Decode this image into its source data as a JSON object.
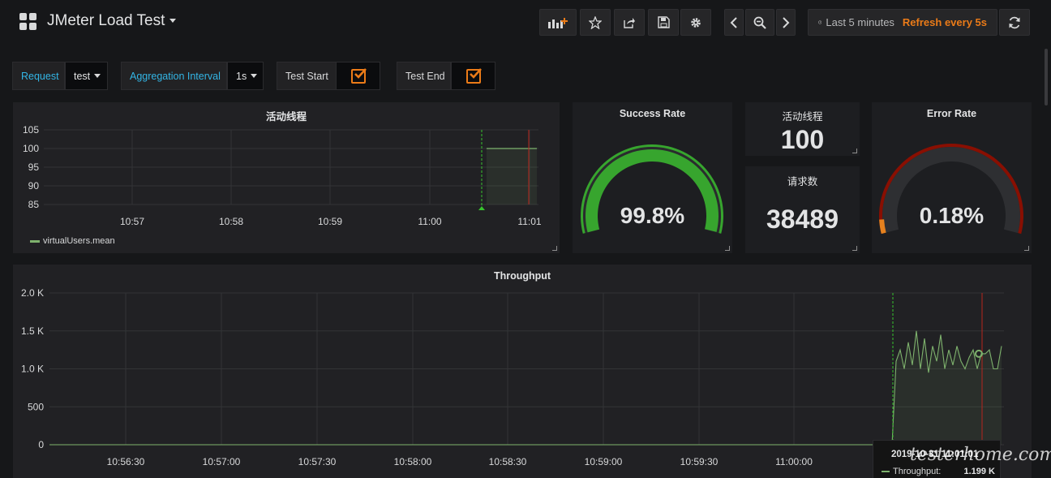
{
  "navbar": {
    "title": "JMeter Load Test",
    "icons": {
      "logo": "dashboard-grid-icon",
      "add_panel": "add-panel-icon",
      "star": "star-icon",
      "share": "share-icon",
      "save": "save-icon",
      "settings": "gear-icon",
      "prev": "chevron-left-icon",
      "zoom": "zoom-out-icon",
      "next": "chevron-right-icon",
      "clock": "clock-icon",
      "refresh": "refresh-icon"
    },
    "time_range": "Last 5 minutes",
    "refresh_label": "Refresh every 5s"
  },
  "variables": {
    "request_label": "Request",
    "request_value": "test",
    "interval_label": "Aggregation Interval",
    "interval_value": "1s",
    "test_start_label": "Test Start",
    "test_end_label": "Test End",
    "test_start_checked": true,
    "test_end_checked": true
  },
  "colors": {
    "accent_orange": "#eb7b18",
    "link_blue": "#33b5e5",
    "series_green": "#7eb26d",
    "gauge_green": "#37a52e",
    "gauge_red": "#890f02",
    "gauge_orange": "#e5811e",
    "background": "#161719",
    "panel": "#212124"
  },
  "panels": {
    "threads": {
      "title": "活动线程",
      "legend": "virtualUsers.mean"
    },
    "success_rate": {
      "title": "Success Rate",
      "value": "99.8%",
      "percent": 99.8
    },
    "threads_stat": {
      "title": "活动线程",
      "value": "100"
    },
    "requests_stat": {
      "title": "请求数",
      "value": "38489"
    },
    "error_rate": {
      "title": "Error Rate",
      "value": "0.18%",
      "percent": 0.18
    },
    "throughput": {
      "title": "Throughput",
      "tooltip_time": "2019-10-31 11:01:01",
      "tooltip_series": "Throughput:",
      "tooltip_value": "1.199 K"
    }
  },
  "chart_data": [
    {
      "type": "line",
      "title": "活动线程",
      "x_ticks": [
        "10:57",
        "10:58",
        "10:59",
        "11:00",
        "11:01"
      ],
      "y_ticks": [
        "85",
        "90",
        "95",
        "100",
        "105"
      ],
      "ylim": [
        85,
        105
      ],
      "grid": true,
      "legend_position": "bottom-left",
      "series": [
        {
          "name": "virtualUsers.mean",
          "x": [
            "11:00:30",
            "11:01:06"
          ],
          "values": [
            100,
            100
          ]
        }
      ],
      "annotations": [
        "Test Start marker (green)",
        "Test End marker (red)"
      ]
    },
    {
      "type": "line",
      "title": "Throughput",
      "x_ticks": [
        "10:56:30",
        "10:57:00",
        "10:57:30",
        "10:58:00",
        "10:58:30",
        "10:59:00",
        "10:59:30",
        "11:00:00"
      ],
      "y_ticks": [
        "0",
        "500",
        "1.0 K",
        "1.5 K",
        "2.0 K"
      ],
      "ylim": [
        0,
        2000
      ],
      "grid": true,
      "series": [
        {
          "name": "Throughput",
          "values_before_start": 0,
          "values": [
            0,
            1100,
            1250,
            1000,
            1350,
            1050,
            1500,
            1000,
            1400,
            950,
            1300,
            1100,
            1450,
            1000,
            1250,
            1050,
            1300,
            1100,
            1000,
            1150,
            1250,
            1000,
            1200,
            1199,
            1250,
            1000,
            1000,
            1300
          ]
        }
      ]
    }
  ],
  "watermark": "testerhome.com"
}
